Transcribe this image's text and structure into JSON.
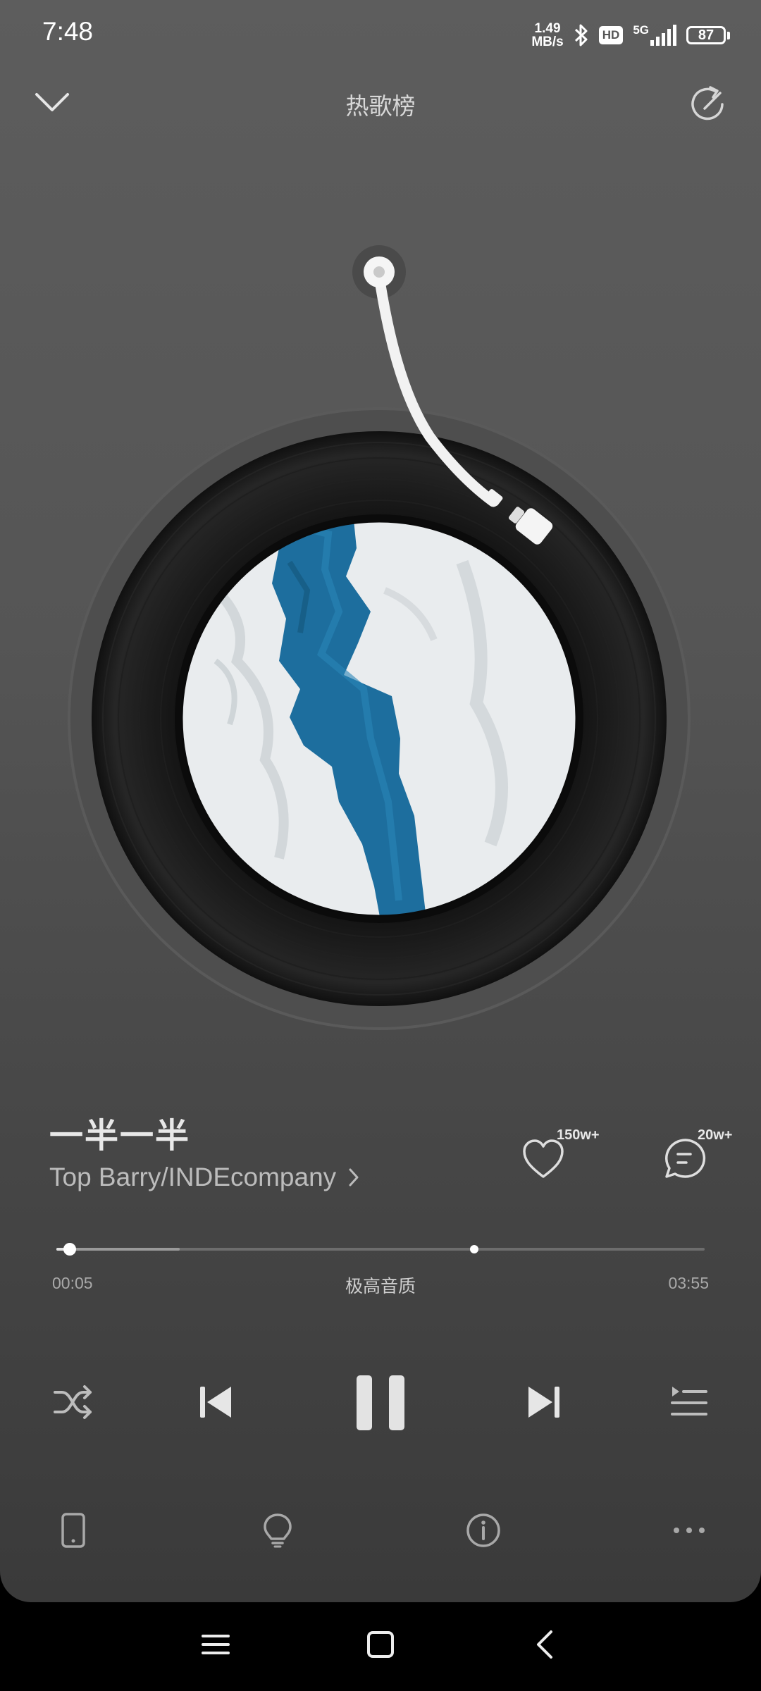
{
  "status_bar": {
    "time": "7:48",
    "net_speed_value": "1.49",
    "net_speed_unit": "MB/s",
    "hd_label": "HD",
    "network_type": "5G",
    "battery": "87"
  },
  "header": {
    "title": "热歌榜"
  },
  "song": {
    "title": "一半一半",
    "artist": "Top Barry/INDEcompany",
    "likes": "150w+",
    "comments": "20w+"
  },
  "progress": {
    "current_time": "00:05",
    "total_time": "03:55",
    "quality": "极高音质",
    "played_fraction": 0.021,
    "buffered_fraction": 0.19,
    "climax_fraction": 0.645
  },
  "colors": {
    "bg_top": "#5d5d5d",
    "bg_bottom": "#3a3a3a",
    "ocean_blue": "#1d6e9e",
    "ice_white": "#e9ecee"
  },
  "icons": {
    "collapse": "chevron-down-icon",
    "share": "share-icon",
    "like": "heart-icon",
    "comment": "comment-icon",
    "shuffle": "shuffle-icon",
    "previous": "skip-previous-icon",
    "pause": "pause-icon",
    "next": "skip-next-icon",
    "playlist": "playlist-icon",
    "device": "phone-device-icon",
    "tips": "lightbulb-icon",
    "info": "info-icon",
    "more": "more-icon"
  }
}
